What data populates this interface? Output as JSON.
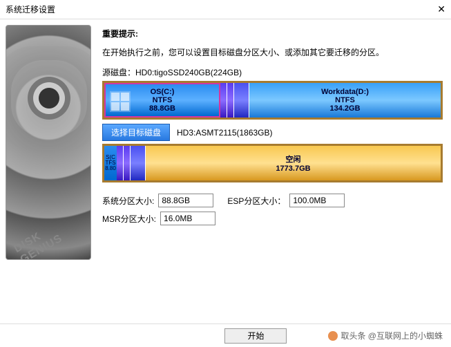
{
  "title": "系统迁移设置",
  "hint_title": "重要提示:",
  "hint_text": "在开始执行之前，您可以设置目标磁盘分区大小、或添加其它要迁移的分区。",
  "source_label": "源磁盘：HD0:tigoSSD240GB(224GB)",
  "source_parts": {
    "os": {
      "name": "OS(C:)",
      "fs": "NTFS",
      "size": "88.8GB"
    },
    "work": {
      "name": "Workdata(D:)",
      "fs": "NTFS",
      "size": "134.2GB"
    }
  },
  "select_target_btn": "选择目标磁盘",
  "target_label": "HD3:ASMT2115(1863GB)",
  "target_parts": {
    "os_tiny": {
      "name": "S(C",
      "fs": "TFS",
      "size": "8.80"
    },
    "free": {
      "name": "空闲",
      "size": "1773.7GB"
    }
  },
  "fields": {
    "sys_size_label": "系统分区大小:",
    "sys_size_value": "88.8GB",
    "esp_size_label": "ESP分区大小：",
    "esp_size_value": "100.0MB",
    "msr_size_label": "MSR分区大小:",
    "msr_size_value": "16.0MB"
  },
  "start_btn": "开始",
  "footer_text": "取头条 @互联网上的小蜘蛛"
}
